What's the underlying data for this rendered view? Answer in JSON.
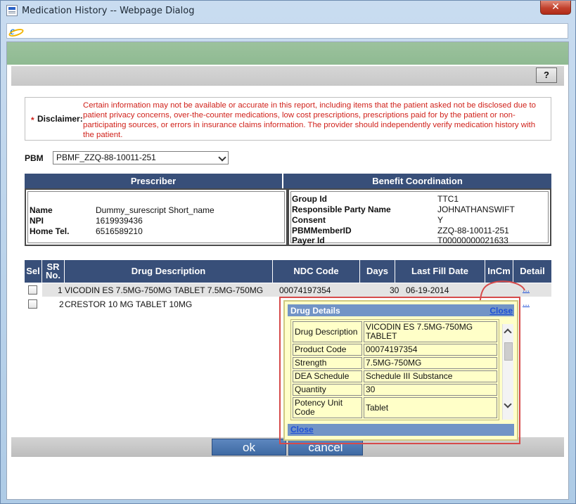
{
  "window": {
    "title": "Medication History -- Webpage Dialog",
    "close_glyph": "✕"
  },
  "toolbar": {
    "help_label": "?"
  },
  "disclaimer": {
    "star": "*",
    "label": "Disclaimer:",
    "text": "Certain information may not be available or accurate in this report, including items that the patient asked not be disclosed due to patient privacy concerns, over-the-counter medications, low cost prescriptions, prescriptions paid for by the patient or non-participating sources, or errors in insurance claims information. The provider should independently verify medication history with the patient."
  },
  "pbm": {
    "label": "PBM",
    "selected": "PBMF_ZZQ-88-10011-251"
  },
  "prescriber": {
    "header": "Prescriber",
    "fields": [
      {
        "label": "Name",
        "value": "Dummy_surescript Short_name"
      },
      {
        "label": "NPI",
        "value": "1619939436"
      },
      {
        "label": "Home Tel.",
        "value": "6516589210"
      }
    ]
  },
  "benefit": {
    "header": "Benefit Coordination",
    "fields": [
      {
        "label": "Group Id",
        "value": "TTC1"
      },
      {
        "label": "Responsible Party Name",
        "value": "JOHNATHANSWIFT"
      },
      {
        "label": "Consent",
        "value": "Y"
      },
      {
        "label": "PBMMemberID",
        "value": "ZZQ-88-10011-251"
      },
      {
        "label": "Payer Id",
        "value": "T00000000021633"
      }
    ]
  },
  "grid": {
    "columns": [
      "Sel",
      "SR No.",
      "Drug Description",
      "NDC Code",
      "Days",
      "Last Fill Date",
      "InCm",
      "Detail"
    ],
    "rows": [
      {
        "sr": "1",
        "drug": "VICODIN ES 7.5MG-750MG TABLET 7.5MG-750MG",
        "ndc": "00074197354",
        "days": "30",
        "last_fill": "06-19-2014",
        "incm": "",
        "detail": "..."
      },
      {
        "sr": "2",
        "drug": "CRESTOR 10 MG TABLET 10MG",
        "ndc": "",
        "days": "",
        "last_fill": "",
        "incm": "",
        "detail": "..."
      }
    ]
  },
  "drug_details": {
    "title": "Drug Details",
    "close_label": "Close",
    "fields": [
      {
        "label": "Drug Description",
        "value": "VICODIN ES 7.5MG-750MG TABLET"
      },
      {
        "label": "Product Code",
        "value": "00074197354"
      },
      {
        "label": "Strength",
        "value": "7.5MG-750MG"
      },
      {
        "label": "DEA Schedule",
        "value": "Schedule III Substance"
      },
      {
        "label": "Quantity",
        "value": "30"
      },
      {
        "label": "Potency Unit Code",
        "value": "Tablet"
      }
    ]
  },
  "actions": {
    "ok_label": "ok",
    "cancel_label": "cancel"
  },
  "colors": {
    "header_navy": "#384f79",
    "disclaimer_red": "#d0221b",
    "popup_yellow": "#ffffc8",
    "popup_header": "#7294c6",
    "annotation_red": "#d64a4a"
  }
}
